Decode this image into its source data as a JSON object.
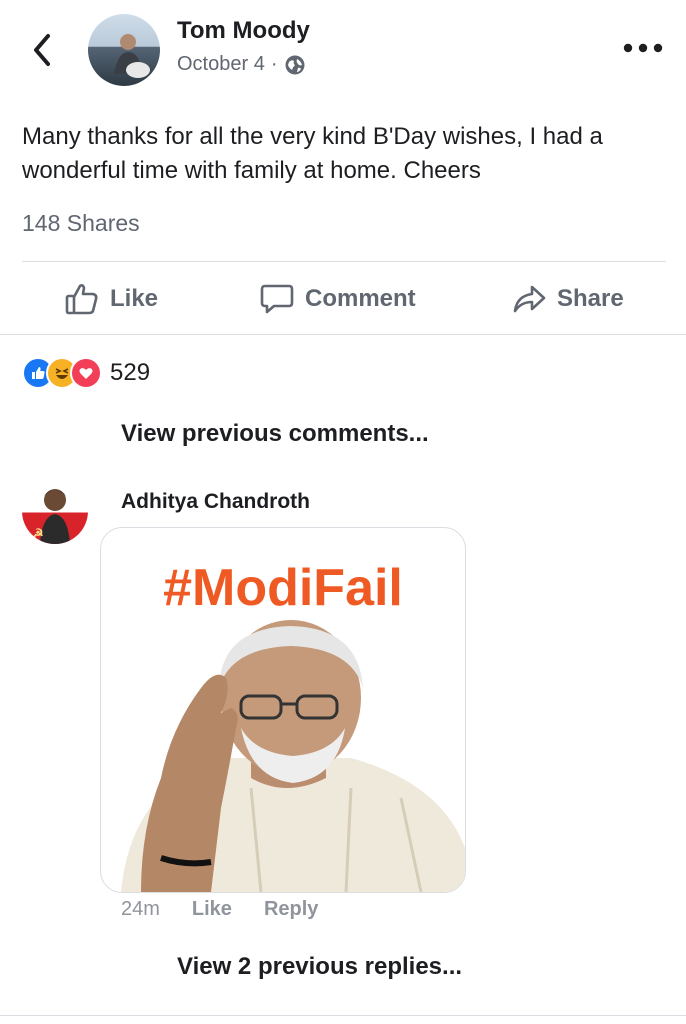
{
  "header": {
    "author_name": "Tom Moody",
    "date": "October 4",
    "separator": "·",
    "privacy_icon": "globe-icon",
    "back_icon": "chevron-left-icon",
    "more_icon": "more-horizontal-icon"
  },
  "post": {
    "text": "Many thanks for all the very kind B'Day wishes, I had a wonderful time with family at home. Cheers",
    "shares": "148 Shares"
  },
  "actions": {
    "like_label": "Like",
    "comment_label": "Comment",
    "share_label": "Share"
  },
  "reactions": {
    "types": [
      "like",
      "haha",
      "love"
    ],
    "count": "529",
    "colors": {
      "like": "#1877f2",
      "haha": "#f7b125",
      "love": "#f33e58"
    }
  },
  "comments": {
    "view_previous": "View previous comments...",
    "items": [
      {
        "author": "Adhitya Chandroth",
        "sticker_text": "#ModiFail",
        "time": "24m",
        "like_label": "Like",
        "reply_label": "Reply"
      }
    ],
    "view_previous_replies": "View 2 previous replies..."
  },
  "theme": {
    "text_primary": "#1c1e21",
    "text_secondary": "#606770",
    "divider": "#dadde1",
    "hashtag_orange": "#ef5a24"
  }
}
